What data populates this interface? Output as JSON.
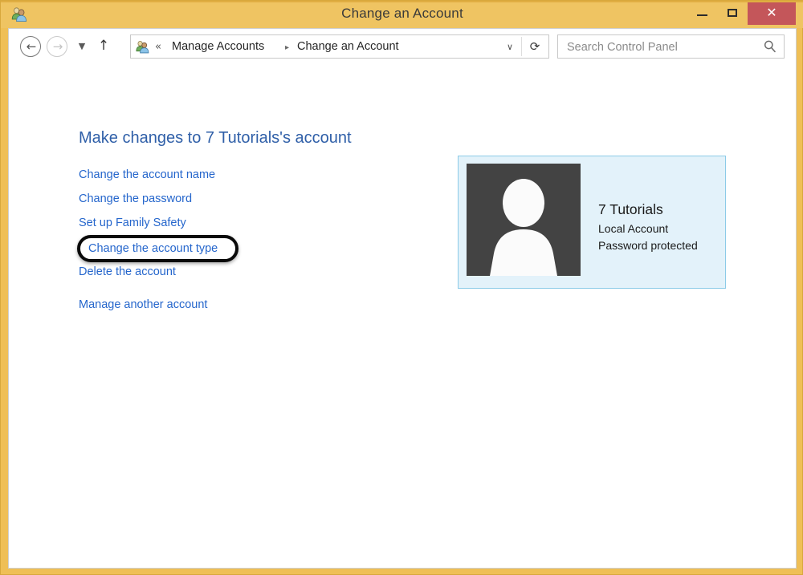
{
  "window": {
    "title": "Change an Account",
    "title_icon": "user-accounts-icon",
    "frame_color": "#efc462",
    "close_button_color": "#c4565a",
    "controls": {
      "minimize_label": "–",
      "maximize_label": "□",
      "close_label": "✕"
    }
  },
  "navbar": {
    "back_icon": "back-arrow-icon",
    "back_glyph": "←",
    "forward_icon": "forward-arrow-icon",
    "forward_glyph": "→",
    "recent_glyph": "▼",
    "up_glyph": "↑",
    "address": {
      "icon": "user-accounts-icon",
      "chevrons": "«",
      "crumbs": [
        {
          "label": "Manage Accounts"
        },
        {
          "label": "Change an Account"
        }
      ],
      "separator": "▸",
      "dropdown_glyph": "∨",
      "refresh_glyph": "⟳"
    },
    "search": {
      "value": "",
      "placeholder": "Search Control Panel",
      "icon": "search-icon"
    }
  },
  "main": {
    "heading": "Make changes to 7 Tutorials's account",
    "tasks": [
      {
        "label": "Change the account name"
      },
      {
        "label": "Change the password"
      },
      {
        "label": "Set up Family Safety"
      },
      {
        "label": "Change the account type"
      },
      {
        "label": "Delete the account"
      },
      {
        "label": "Manage another account"
      }
    ],
    "highlight": {
      "target_label": "Change the account type",
      "color": "#0a0a0a"
    },
    "link_color": "#2566cc",
    "heading_color": "#2f5fa8"
  },
  "account": {
    "name": "7 Tutorials",
    "type": "Local Account",
    "protection": "Password protected",
    "avatar_icon": "user-silhouette-avatar",
    "panel_background": "#e3f2fa",
    "panel_border": "#8ccbe8",
    "avatar_background": "#434343"
  }
}
